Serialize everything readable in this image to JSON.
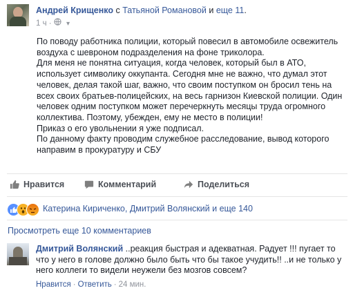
{
  "post": {
    "author": "Андрей Крищенко",
    "with_word": "с",
    "tagged": "Татьяной Романовой",
    "and_word": "и",
    "others": "еще 11",
    "period": ".",
    "time": "1 ч",
    "audience_icon": "globe-icon",
    "paragraphs": [
      "По поводу работника полиции, который повесил в автомобиле освежитель воздуха с шевроном подразделения на фоне триколора.",
      "Для меня не понятна ситуация, когда человек, который был в АТО, использует символику оккупанта. Сегодня мне не важно, что думал этот человек, делая такой шаг, важно, что своим поступком он бросил тень на всех своих братьев-полицейских, на весь гарнизон Киевской полиции. Один человек одним поступком может перечеркнуть месяцы труда огромного коллектива. Поэтому, убежден, ему не место в полиции!",
      "Приказ о его увольнении я уже подписал.",
      "По данному факту проводим служебное расследование, вывод которого направим в прокуратуру и СБУ"
    ]
  },
  "actions": {
    "like": "Нравится",
    "comment": "Комментарий",
    "share": "Поделиться"
  },
  "reactions": {
    "icons": [
      "like-icon",
      "wow-icon",
      "angry-icon"
    ],
    "names": "Катерина Кириченко, Дмитрий Волянский и еще 140"
  },
  "comments": {
    "view_more": "Просмотреть еще 10 комментариев",
    "items": [
      {
        "author": "Дмитрий Волянский",
        "text": " ..реакция быстрая и адекватная. Радует !!! пугает то что у него в голове должно было быть что бы такое учудить!! ..и не только у него коллеги то видели неужели без мозгов совсем?",
        "like": "Нравится",
        "reply": "Ответить",
        "time": "24 мин."
      }
    ]
  },
  "colors": {
    "link": "#365899",
    "text": "#1d2129",
    "muted": "#90949c"
  }
}
